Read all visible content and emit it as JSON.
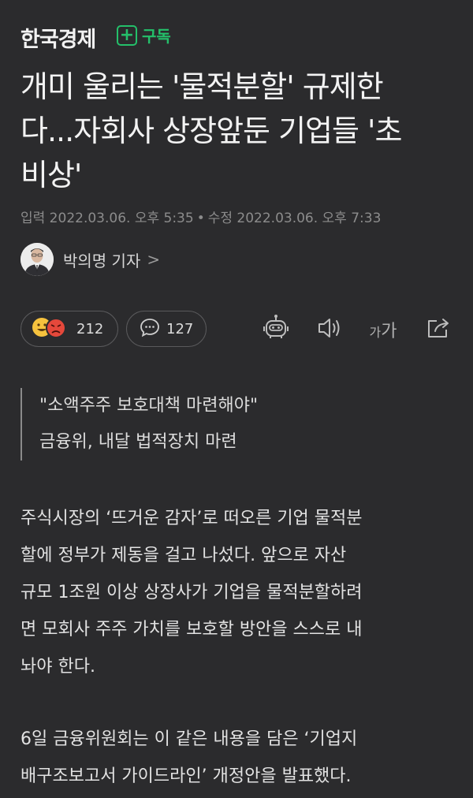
{
  "header": {
    "press_name": "한국경제",
    "subscribe_label": "구독",
    "subscribe_icon": "plus-icon"
  },
  "article": {
    "headline_lines": [
      "개미 울리는 '물적분할' 규제한",
      "다...자회사 상장앞둔 기업들 '초",
      "비상'"
    ],
    "published": "입력 2022.03.06. 오후 5:35",
    "modified": "수정 2022.03.06. 오후 7:33",
    "separator": "•",
    "reporter": "박의명 기자",
    "reporter_chevron": ">"
  },
  "actions": {
    "reaction_count": "212",
    "comment_count": "127",
    "font_size_small": "가",
    "font_size_large": "가",
    "icons": [
      "reaction-emoji-icon",
      "comment-icon",
      "robot-summary-icon",
      "speaker-icon",
      "font-size-icon",
      "share-icon"
    ]
  },
  "summary": {
    "lines": [
      "\"소액주주 보호대책 마련해야\"",
      "금융위, 내달 법적장치 마련"
    ]
  },
  "body": {
    "paragraph1_lines": [
      "주식시장의 ‘뜨거운 감자’로 떠오른 기업 물적분",
      "할에 정부가 제동을 걸고 나섰다. 앞으로 자산",
      "규모 1조원 이상 상장사가 기업을 물적분할하려",
      "면 모회사 주주 가치를 보호할 방안을 스스로 내",
      "놔야 한다."
    ],
    "paragraph2_lines": [
      "6일 금융위원회는 이 같은 내용을 담은 ‘기업지",
      "배구조보고서 가이드라인’ 개정안을 발표했다."
    ]
  },
  "colors": {
    "background": "#2b2b2d",
    "accent_green": "#24c06a",
    "text": "#e8e8e8",
    "muted": "#8c8c8c"
  }
}
